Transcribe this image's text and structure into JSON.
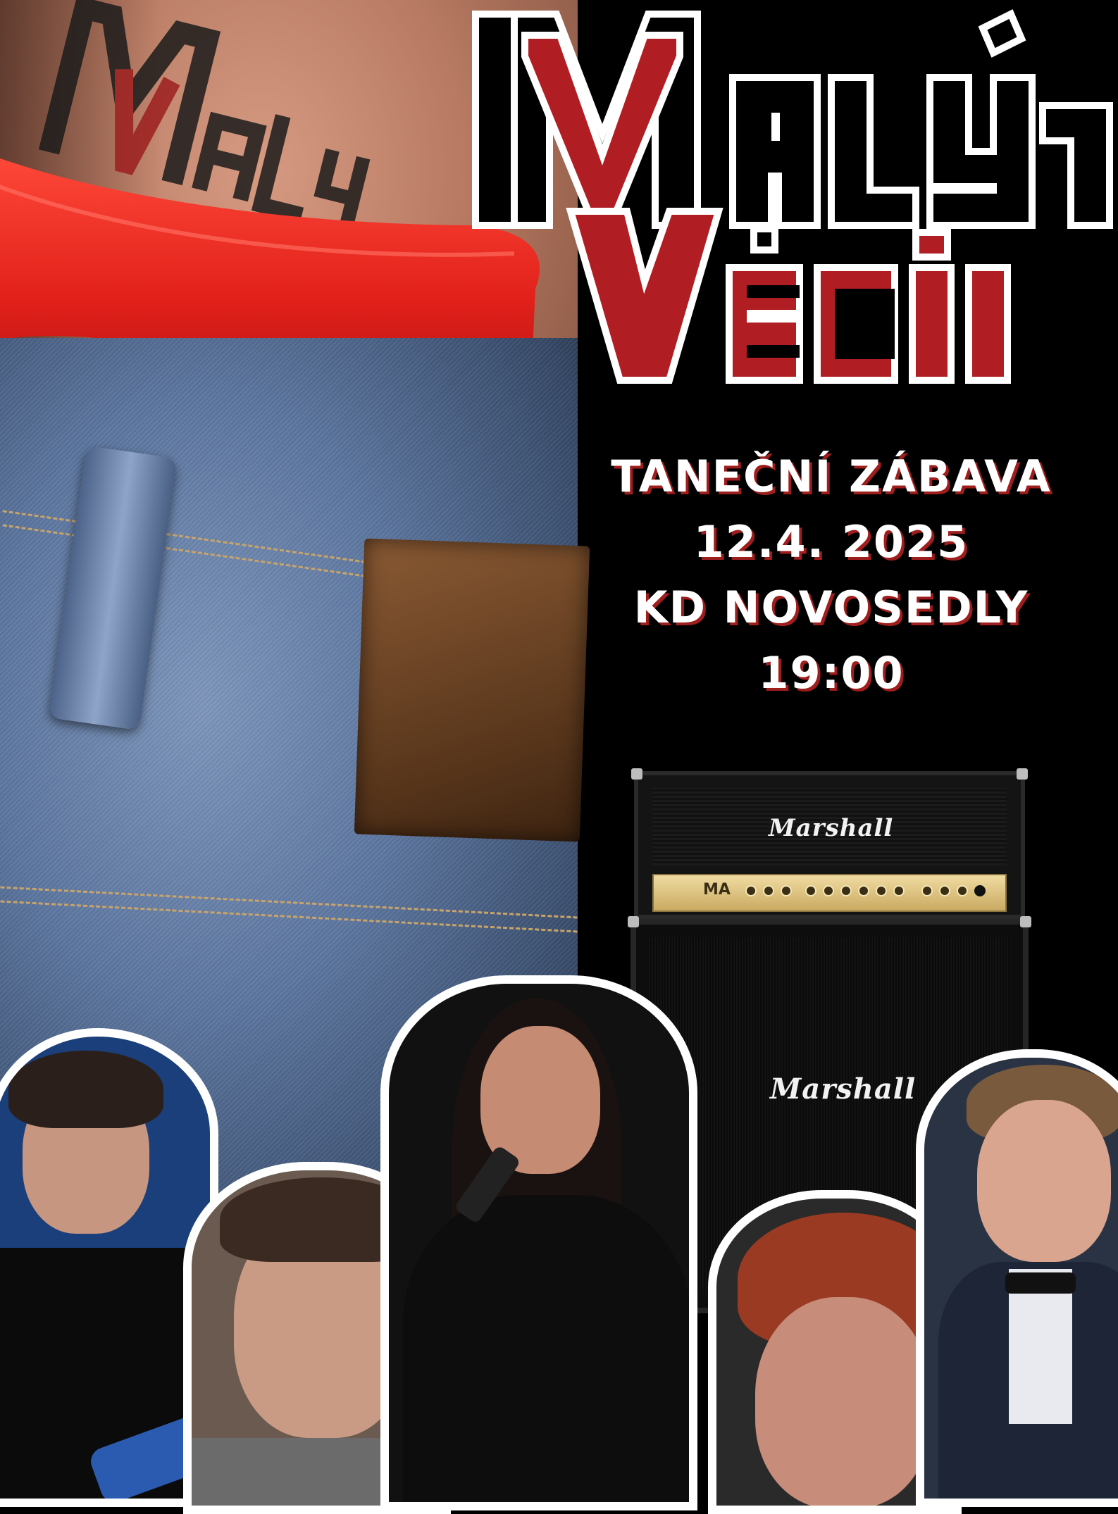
{
  "band_logo": {
    "line1": "MALÝ",
    "line2": "VĚCI",
    "colors": {
      "red": "#b01e23",
      "black": "#000000",
      "outline": "#ffffff"
    }
  },
  "event": {
    "line1": "TANEČNÍ ZÁBAVA",
    "line2": "12.4. 2025",
    "line3": "KD NOVOSEDLY",
    "line4": "19:00"
  },
  "amp": {
    "head_brand": "Marshall",
    "cab_brand": "Marshall",
    "panel_badge": "MA"
  },
  "images": {
    "background_photo": "red underwear and jeans",
    "members": [
      "guitarist",
      "drummer",
      "singer",
      "keyboardist",
      "bassist"
    ]
  }
}
